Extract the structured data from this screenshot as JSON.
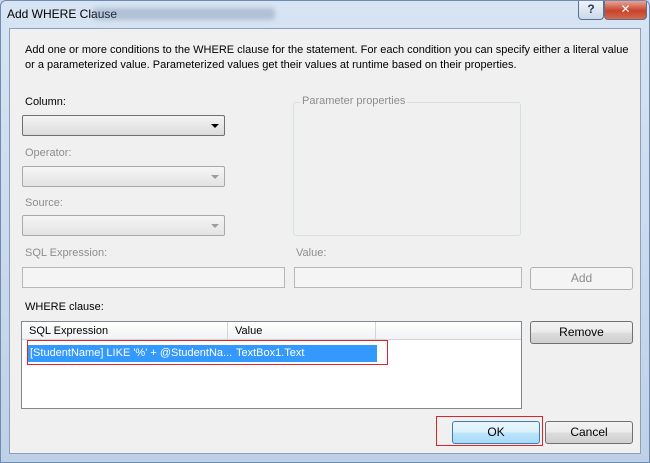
{
  "window": {
    "title": "Add WHERE Clause",
    "help_glyph": "?",
    "close_glyph": "✕"
  },
  "description": "Add one or more conditions to the WHERE clause for the statement. For each condition you can specify either a literal value or a parameterized value. Parameterized values get their values at runtime based on their properties.",
  "form": {
    "column_label": "Column:",
    "column_value": "",
    "operator_label": "Operator:",
    "operator_value": "",
    "source_label": "Source:",
    "source_value": "",
    "parameter_properties_label": "Parameter properties",
    "sql_expression_label": "SQL Expression:",
    "sql_expression_value": "",
    "value_label": "Value:",
    "value_value": "",
    "add_button": "Add"
  },
  "where_clause": {
    "label": "WHERE clause:",
    "columns": [
      "SQL Expression",
      "Value"
    ],
    "rows": [
      {
        "sql_expression": "[StudentName] LIKE '%' + @StudentNa...",
        "value": "TextBox1.Text",
        "selected": true
      }
    ],
    "remove_button": "Remove"
  },
  "footer": {
    "ok_button": "OK",
    "cancel_button": "Cancel"
  },
  "colors": {
    "selection": "#3399ff",
    "highlight_border": "#e0222a"
  }
}
